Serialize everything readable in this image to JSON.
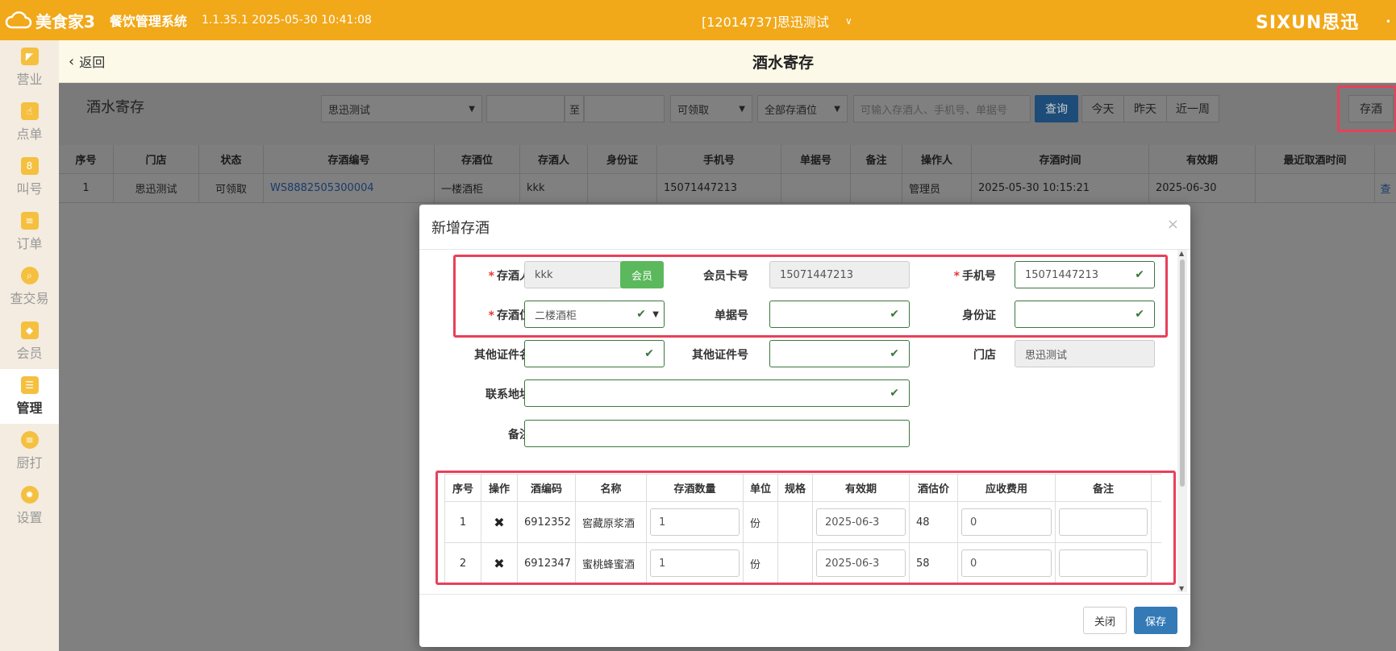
{
  "header": {
    "logo_text": "美食家3",
    "system_name": "餐饮管理系统",
    "version": "1.1.35.1 2025-05-30 10:41:08",
    "store": "[12014737]思迅测试",
    "brand": "SIXUN思迅"
  },
  "sidebar": {
    "items": [
      {
        "label": "营业",
        "icon": "business-icon"
      },
      {
        "label": "点单",
        "icon": "order-icon"
      },
      {
        "label": "叫号",
        "icon": "call-number-icon"
      },
      {
        "label": "订单",
        "icon": "orders-icon"
      },
      {
        "label": "查交易",
        "icon": "search-trade-icon"
      },
      {
        "label": "会员",
        "icon": "member-icon"
      },
      {
        "label": "管理",
        "icon": "manage-icon"
      },
      {
        "label": "厨打",
        "icon": "kitchen-print-icon"
      },
      {
        "label": "设置",
        "icon": "settings-icon"
      }
    ],
    "active": "管理"
  },
  "subheader": {
    "back_label": "返回",
    "title": "酒水寄存"
  },
  "filter": {
    "section_title": "酒水寄存",
    "store_select": "思迅测试",
    "to_label": "至",
    "status_select": "可领取",
    "location_select": "全部存酒位",
    "search_placeholder": "可输入存酒人、手机号、单据号",
    "query_button": "查询",
    "today": "今天",
    "yesterday": "昨天",
    "week": "近一周",
    "store_button": "存酒"
  },
  "grid": {
    "headers": [
      "序号",
      "门店",
      "状态",
      "存酒编号",
      "存酒位",
      "存酒人",
      "身份证",
      "手机号",
      "单据号",
      "备注",
      "操作人",
      "存酒时间",
      "有效期",
      "最近取酒时间",
      ""
    ],
    "rows": [
      [
        "1",
        "思迅测试",
        "可领取",
        "WS8882505300004",
        "一楼酒柜",
        "kkk",
        "",
        "15071447213",
        "",
        "",
        "管理员",
        "2025-05-30 10:15:21",
        "2025-06-30",
        "",
        "查"
      ]
    ]
  },
  "dialog": {
    "title": "新增存酒",
    "labels": {
      "depositor": "存酒人",
      "card_no": "会员卡号",
      "phone": "手机号",
      "location": "存酒位",
      "bill_no": "单据号",
      "id_card": "身份证",
      "other_cert_name": "其他证件名",
      "other_cert_no": "其他证件号",
      "store": "门店",
      "address": "联系地址",
      "remark": "备注"
    },
    "values": {
      "depositor": "kkk",
      "card_no": "15071447213",
      "phone": "15071447213",
      "location": "二楼酒柜",
      "store": "思迅测试"
    },
    "member_button": "会员",
    "item_headers": [
      "序号",
      "操作",
      "酒编码",
      "名称",
      "存酒数量",
      "单位",
      "规格",
      "有效期",
      "酒估价",
      "应收费用",
      "备注"
    ],
    "items": [
      {
        "no": "1",
        "code": "6912352",
        "name": "窖藏原浆酒",
        "qty": "1",
        "unit": "份",
        "spec": "",
        "expiry": "2025-06-3",
        "price": "48",
        "fee": "0",
        "remark": ""
      },
      {
        "no": "2",
        "code": "6912347",
        "name": "蜜桃蜂蜜酒",
        "qty": "1",
        "unit": "份",
        "spec": "",
        "expiry": "2025-06-3",
        "price": "58",
        "fee": "0",
        "remark": ""
      }
    ],
    "close_button": "关闭",
    "save_button": "保存"
  }
}
